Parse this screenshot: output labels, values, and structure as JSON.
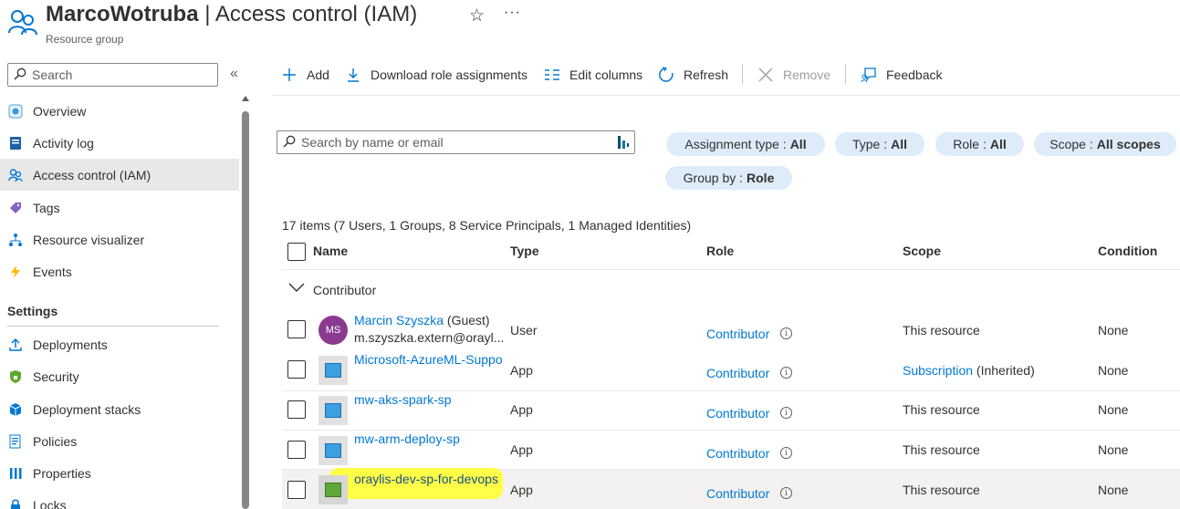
{
  "header": {
    "resource_name": "MarcoWotruba",
    "separator": " | ",
    "page_name": "Access control (IAM)",
    "subtitle": "Resource group",
    "favorite_icon": "star-icon",
    "more_icon": "more-icon",
    "more_text": "···"
  },
  "sidebar": {
    "search_placeholder": "Search",
    "collapse_glyph": "«",
    "items": [
      {
        "label": "Overview",
        "icon": "overview-icon"
      },
      {
        "label": "Activity log",
        "icon": "activity-log-icon"
      },
      {
        "label": "Access control (IAM)",
        "icon": "iam-icon",
        "active": true
      },
      {
        "label": "Tags",
        "icon": "tag-icon"
      },
      {
        "label": "Resource visualizer",
        "icon": "visualizer-icon"
      },
      {
        "label": "Events",
        "icon": "events-icon"
      }
    ],
    "settings_heading": "Settings",
    "settings_items": [
      {
        "label": "Deployments",
        "icon": "deployments-icon"
      },
      {
        "label": "Security",
        "icon": "security-icon"
      },
      {
        "label": "Deployment stacks",
        "icon": "deployment-stacks-icon"
      },
      {
        "label": "Policies",
        "icon": "policies-icon"
      },
      {
        "label": "Properties",
        "icon": "properties-icon"
      },
      {
        "label": "Locks",
        "icon": "lock-icon"
      }
    ]
  },
  "toolbar": {
    "add": "Add",
    "download": "Download role assignments",
    "edit_columns": "Edit columns",
    "refresh": "Refresh",
    "remove": "Remove",
    "feedback": "Feedback"
  },
  "filters": {
    "search_placeholder": "Search by name or email",
    "pills": [
      {
        "label": "Assignment type :",
        "value": "All"
      },
      {
        "label": "Type :",
        "value": "All"
      },
      {
        "label": "Role :",
        "value": "All"
      },
      {
        "label": "Scope :",
        "value": "All scopes"
      },
      {
        "label": "Group by :",
        "value": "Role"
      }
    ]
  },
  "summary": "17 items (7 Users, 1 Groups, 8 Service Principals, 1 Managed Identities)",
  "table": {
    "columns": [
      "Name",
      "Type",
      "Role",
      "Scope",
      "Condition"
    ],
    "group": "Contributor",
    "rows": [
      {
        "name": "Marcin Szyszka",
        "suffix": " (Guest)",
        "sub": "m.szyszka.extern@orayl...",
        "avatar": "MS",
        "type": "User",
        "role": "Contributor",
        "scope": "This resource",
        "scope_link": "",
        "scope_suffix": "",
        "condition": "None"
      },
      {
        "name": "Microsoft-AzureML-Suppo",
        "type": "App",
        "role": "Contributor",
        "scope": "",
        "scope_link": "Subscription",
        "scope_suffix": " (Inherited)",
        "condition": "None"
      },
      {
        "name": "mw-aks-spark-sp",
        "type": "App",
        "role": "Contributor",
        "scope": "This resource",
        "condition": "None"
      },
      {
        "name": "mw-arm-deploy-sp",
        "type": "App",
        "role": "Contributor",
        "scope": "This resource",
        "condition": "None"
      },
      {
        "name": "oraylis-dev-sp-for-devops",
        "type": "App",
        "role": "Contributor",
        "scope": "This resource",
        "condition": "None",
        "highlighted": true
      }
    ],
    "info_glyph": "i"
  }
}
